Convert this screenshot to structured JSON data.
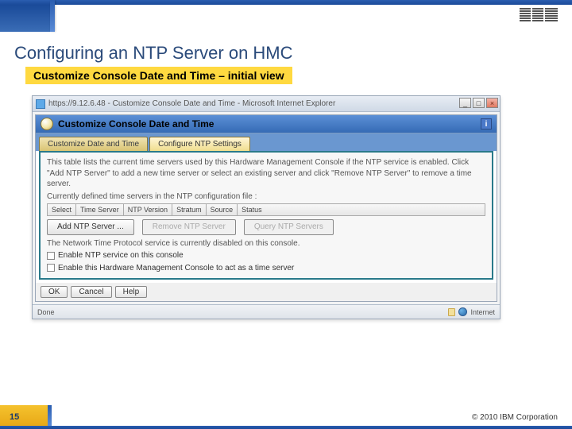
{
  "slide": {
    "title": "Configuring an NTP Server on HMC",
    "subtitle": "Customize Console Date and Time – initial view",
    "page_number": "15",
    "copyright": "© 2010 IBM Corporation",
    "logo_alt": "IBM"
  },
  "browser": {
    "title": "https://9.12.6.48 - Customize Console Date and Time - Microsoft Internet Explorer",
    "min": "_",
    "max": "□",
    "close": "×",
    "status_left": "Done",
    "status_right": "Internet"
  },
  "panel": {
    "heading": "Customize Console Date and Time",
    "info": "i",
    "tabs": {
      "configure": "Configure NTP Settings",
      "datetime": "Customize Date and Time"
    },
    "intro": "This table lists the current time servers used by this Hardware Management Console if the NTP service is enabled. Click \"Add NTP Server\" to add a new time server or select an existing server and click \"Remove NTP Server\" to remove a time server.",
    "subhead": "Currently defined time servers in the NTP configuration file :",
    "cols": {
      "select": "Select",
      "server": "Time Server",
      "ver": "NTP Version",
      "stratum": "Stratum",
      "source": "Source",
      "status": "Status"
    },
    "buttons": {
      "add": "Add NTP Server ...",
      "remove": "Remove NTP Server",
      "query": "Query NTP Servers"
    },
    "disabled_msg": "The Network Time Protocol service is currently disabled on this console.",
    "cb1": "Enable NTP service on this console",
    "cb2": "Enable this Hardware Management Console to act as a time server",
    "dlg": {
      "ok": "OK",
      "cancel": "Cancel",
      "help": "Help"
    }
  }
}
